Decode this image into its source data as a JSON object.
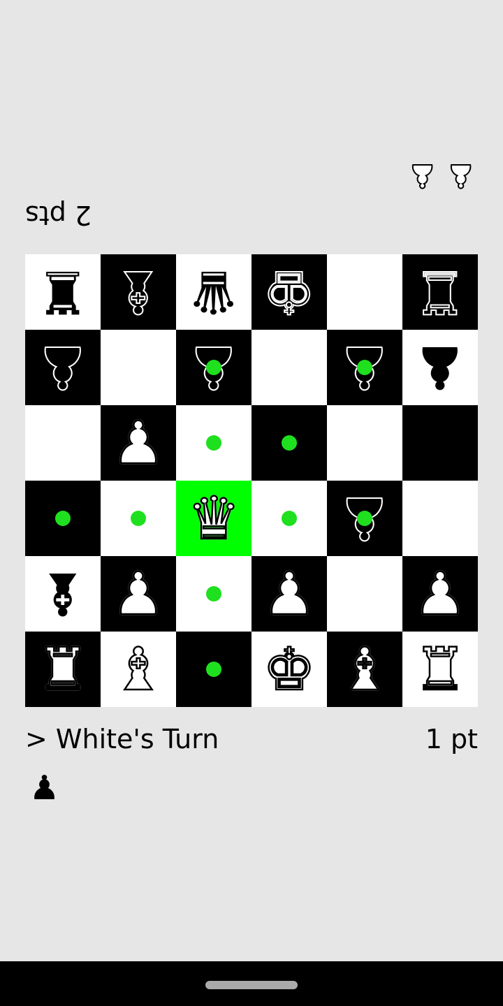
{
  "opponent": {
    "score": "2 pts",
    "captured": [
      "wP",
      "wP"
    ]
  },
  "player": {
    "turn": "> White's Turn",
    "score": "1 pt",
    "captured": [
      "bP"
    ]
  },
  "colors": {
    "highlight": "#00ff00",
    "move_dot": "#1fe01f",
    "light_square": "#ffffff",
    "dark_square": "#000000",
    "background": "#e6e6e6"
  },
  "board": [
    [
      "bR",
      "bB",
      "bQ",
      "bK",
      "",
      "bR"
    ],
    [
      "bP",
      "",
      "bP",
      "",
      "bP",
      "bP"
    ],
    [
      "",
      "wP",
      "",
      "",
      "",
      ""
    ],
    [
      "",
      "",
      "wQ",
      "",
      "bP",
      ""
    ],
    [
      "bB",
      "wP",
      "",
      "wP",
      "",
      "wP"
    ],
    [
      "wR",
      "wB",
      "",
      "wK",
      "wB",
      "wR"
    ]
  ],
  "selected": "r3c2",
  "move_dots": [
    "r1c2",
    "r1c4",
    "r2c2",
    "r2c3",
    "r3c0",
    "r3c1",
    "r3c3",
    "r3c4",
    "r4c2",
    "r5c2"
  ]
}
